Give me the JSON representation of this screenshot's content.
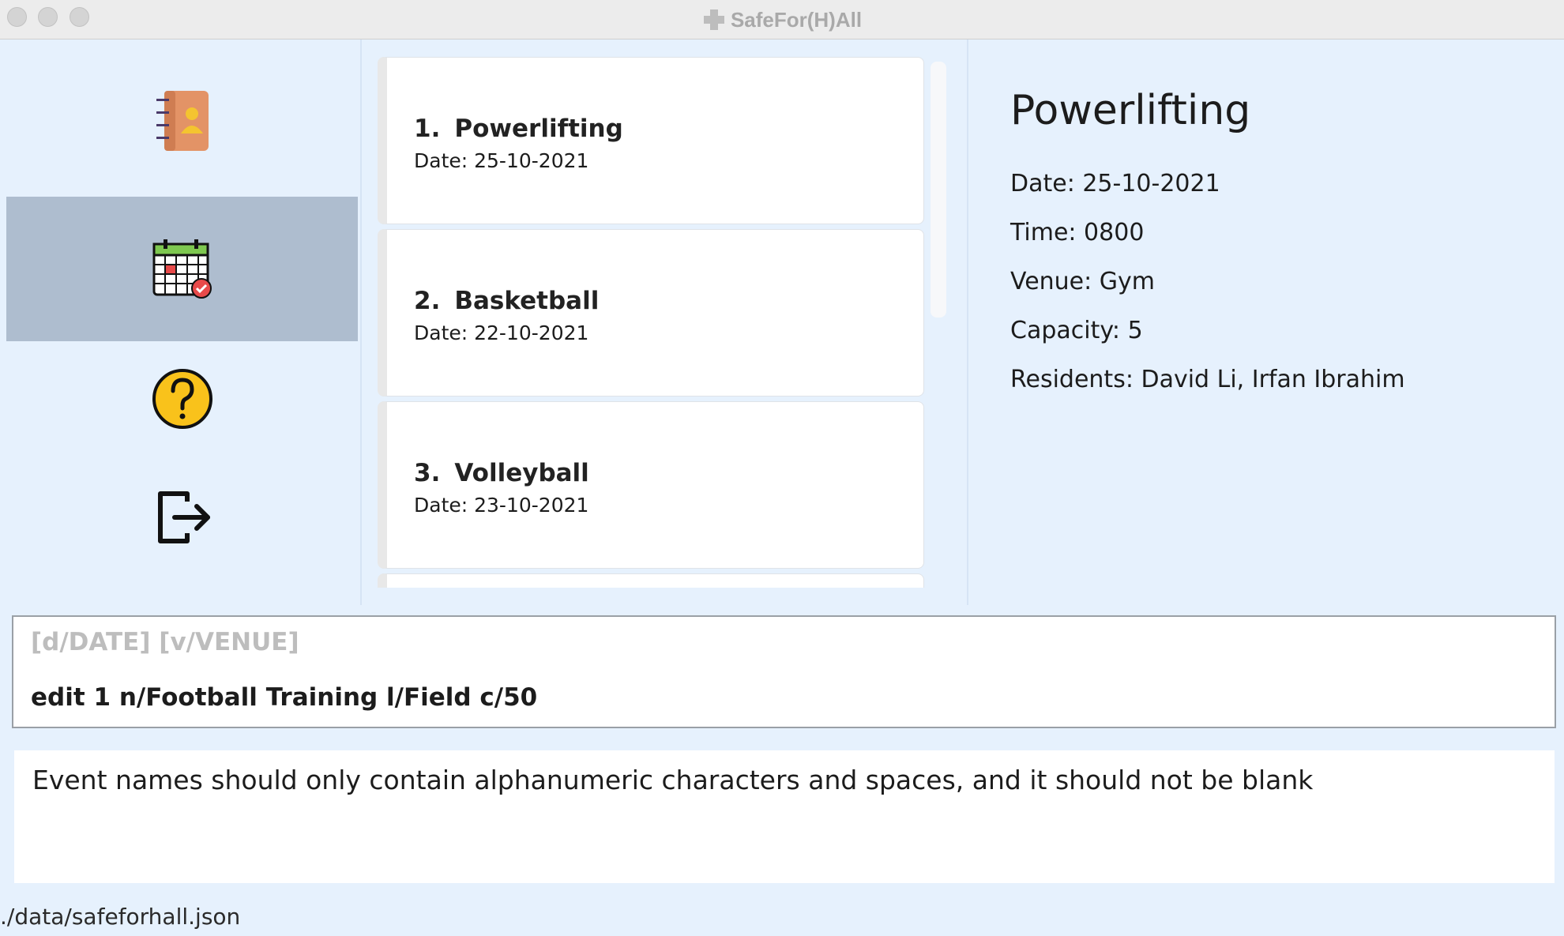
{
  "window": {
    "title": "SafeFor(H)All"
  },
  "sidebar": {
    "items": [
      {
        "name": "residents",
        "icon": "address-book-icon",
        "selected": false
      },
      {
        "name": "events",
        "icon": "calendar-icon",
        "selected": true
      },
      {
        "name": "help",
        "icon": "help-icon",
        "selected": false
      },
      {
        "name": "exit",
        "icon": "exit-icon",
        "selected": false
      }
    ]
  },
  "event_list": {
    "items": [
      {
        "index": "1.",
        "name": "Powerlifting",
        "date": "Date: 25-10-2021"
      },
      {
        "index": "2.",
        "name": "Basketball",
        "date": "Date: 22-10-2021"
      },
      {
        "index": "3.",
        "name": "Volleyball",
        "date": "Date: 23-10-2021"
      }
    ]
  },
  "detail": {
    "title": "Powerlifting",
    "date": "Date: 25-10-2021",
    "time": "Time: 0800",
    "venue": "Venue: Gym",
    "capacity": "Capacity: 5",
    "residents": "Residents: David Li, Irfan Ibrahim"
  },
  "command_box": {
    "hint": "[d/DATE] [v/VENUE]",
    "value": "edit 1 n/Football Training l/Field c/50"
  },
  "result_display": {
    "message": "Event names should only contain alphanumeric characters and spaces, and it should not be blank"
  },
  "status_bar": {
    "file_path": "./data/safeforhall.json"
  },
  "colors": {
    "background": "#e6f1fd",
    "selected_sidebar": "#aebdcf",
    "card": "#ffffff",
    "hint_text": "#bdbdbd"
  }
}
